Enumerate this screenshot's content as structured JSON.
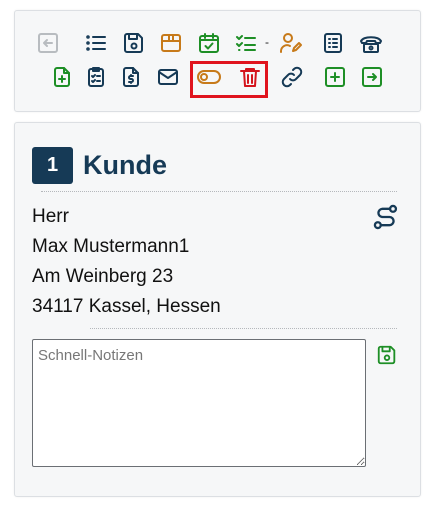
{
  "colors": {
    "navy": "#163a56",
    "green": "#1e8f26",
    "orange": "#c77a1a",
    "red": "#d4141c",
    "disabled": "#b8bcc0",
    "highlight": "#e0141e"
  },
  "toolbar": {
    "row1": [
      {
        "name": "back-icon",
        "icon": "arrow-left-to-line",
        "color": "#b8bcc0"
      },
      {
        "name": "list-icon",
        "icon": "list",
        "color": "#163a56"
      },
      {
        "name": "save-icon",
        "icon": "floppy-disk",
        "color": "#163a56"
      },
      {
        "name": "archive-icon",
        "icon": "box",
        "color": "#c77a1a"
      },
      {
        "name": "calendar-check-icon",
        "icon": "calendar-check",
        "color": "#1e8f26"
      },
      {
        "name": "checklist-icon",
        "icon": "checklist",
        "color": "#1e8f26"
      },
      {
        "name": "user-edit-icon",
        "icon": "user-pen",
        "color": "#c77a1a"
      },
      {
        "name": "list-detail-icon",
        "icon": "clipboard-list",
        "color": "#163a56"
      },
      {
        "name": "phone-icon",
        "icon": "telephone",
        "color": "#163a56"
      }
    ],
    "row2": [
      {
        "name": "file-add-icon",
        "icon": "file-plus",
        "color": "#1e8f26"
      },
      {
        "name": "clipboard-check-icon",
        "icon": "clipboard-check",
        "color": "#163a56"
      },
      {
        "name": "invoice-icon",
        "icon": "file-dollar",
        "color": "#163a56"
      },
      {
        "name": "mail-icon",
        "icon": "envelope",
        "color": "#163a56"
      },
      {
        "name": "toggle-icon",
        "icon": "toggle-off",
        "color": "#c77a1a"
      },
      {
        "name": "trash-icon",
        "icon": "trash",
        "color": "#d4141c"
      },
      {
        "name": "link-icon",
        "icon": "link",
        "color": "#163a56"
      },
      {
        "name": "add-icon",
        "icon": "square-plus",
        "color": "#1e8f26"
      },
      {
        "name": "forward-icon",
        "icon": "square-arrow-right",
        "color": "#1e8f26"
      }
    ],
    "separator": "-"
  },
  "customer": {
    "number": "1",
    "title": "Kunde",
    "salutation": "Herr",
    "name": "Max Mustermann1",
    "street": "Am Weinberg 23",
    "city": "34117 Kassel, Hessen",
    "route_icon": "route-icon"
  },
  "notes": {
    "placeholder": "Schnell-Notizen",
    "value": "",
    "save_icon": "save-icon"
  }
}
